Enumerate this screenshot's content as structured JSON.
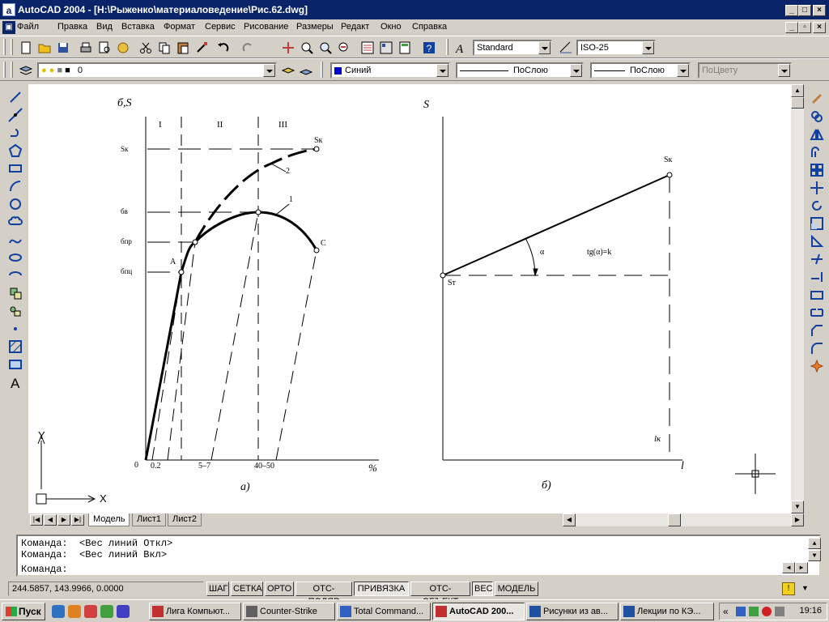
{
  "window": {
    "title": "AutoCAD 2004 - [H:\\Рыженко\\материаловедение\\Рис.62.dwg]",
    "app_icon_letter": "a",
    "controls": {
      "minimize": "_",
      "maximize": "□",
      "close": "×"
    }
  },
  "menu": {
    "items": [
      "Файл",
      "Правка",
      "Вид",
      "Вставка",
      "Формат",
      "Сервис",
      "Рисование",
      "Размеры",
      "Редакт",
      "Окно",
      "Справка"
    ]
  },
  "toolbar": {
    "text_style": "Standard",
    "dim_style": "ISO-25",
    "layer": "0",
    "color": "Синий",
    "color_hex": "#0000cc",
    "linetype": "ПоСлою",
    "lineweight": "ПоСлою",
    "plot_style": "ПоЦвету"
  },
  "drawing": {
    "left": {
      "y_axis_label": "б,S",
      "zones": [
        "I",
        "II",
        "III"
      ],
      "y_labels": {
        "sk": "Sк",
        "bv": "бв",
        "bpr": "бпр",
        "bpts": "бпц"
      },
      "point_labels": {
        "s_end": "Sк",
        "curve2": "2",
        "curve1": "1",
        "point_a": "A",
        "point_c": "C"
      },
      "x_labels": {
        "zero": "0",
        "x1": "0.2",
        "x2": "5–7",
        "x3": "40–50",
        "unit": "%"
      },
      "caption": "а)"
    },
    "right": {
      "y_axis_label": "S",
      "top_point": "Sк",
      "start_point": "Sт",
      "angle": "α",
      "formula": "tg(α)=k",
      "l_marker": "lк",
      "x_axis_label": "l",
      "caption": "б)"
    },
    "ucs": {
      "x": "X",
      "y": "Y"
    }
  },
  "tabs": {
    "model": "Модель",
    "sheet1": "Лист1",
    "sheet2": "Лист2"
  },
  "command": {
    "lines": [
      "Команда:  <Вес линий Откл>",
      "Команда:  <Вес линий Вкл>"
    ],
    "prompt": "Команда:"
  },
  "status": {
    "coords": "244.5857, 143.9966, 0.0000",
    "buttons": [
      "ШАГ",
      "СЕТКА",
      "ОРТО",
      "ОТС-ПОЛЯР",
      "ПРИВЯЗКА",
      "ОТС-ОБЪЕКТ",
      "ВЕС",
      "МОДЕЛЬ"
    ]
  },
  "taskbar": {
    "start": "Пуск",
    "tasks": [
      "Лига Компьют...",
      "Counter-Strike",
      "Total Command...",
      "AutoCAD 200...",
      "Рисунки из ав...",
      "Лекции по КЭ..."
    ],
    "tray_arrows": "«",
    "clock": "19:16"
  }
}
